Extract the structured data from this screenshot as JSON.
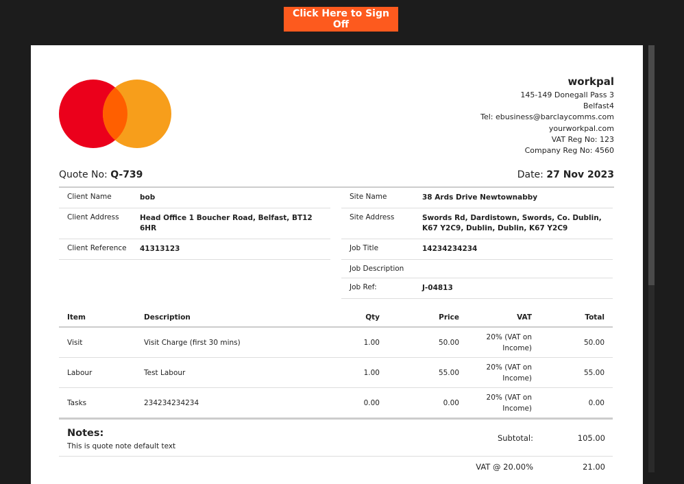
{
  "signoff_button": "Click Here to Sign Off",
  "company": {
    "name": "workpal",
    "address1": "145-149 Donegall Pass 3",
    "address2": "Belfast4",
    "tel": "Tel: ebusiness@barclaycomms.com",
    "web": "yourworkpal.com",
    "vat_reg": "VAT Reg No: 123",
    "company_reg": "Company Reg No: 4560"
  },
  "logo": {
    "left_color": "#eb001b",
    "right_color": "#f79e1b",
    "overlap_color": "#ff5f00"
  },
  "quote": {
    "label": "Quote No: ",
    "number": "Q-739"
  },
  "date": {
    "label": "Date: ",
    "value": "27 Nov 2023"
  },
  "client_info": [
    {
      "label": "Client Name",
      "value": "bob"
    },
    {
      "label": "Client Address",
      "value": "Head Office 1 Boucher Road, Belfast, BT12 6HR"
    },
    {
      "label": "Client Reference",
      "value": "41313123"
    }
  ],
  "site_info": [
    {
      "label": "Site Name",
      "value": "38 Ards Drive Newtownabby"
    },
    {
      "label": "Site Address",
      "value": "Swords Rd, Dardistown, Swords, Co. Dublin, K67 Y2C9, Dublin, Dublin, K67 Y2C9"
    },
    {
      "label": "Job Title",
      "value": "14234234234"
    },
    {
      "label": "Job Description",
      "value": ""
    },
    {
      "label": "Job Ref:",
      "value": "J-04813"
    }
  ],
  "items_table": {
    "headers": {
      "item": "Item",
      "description": "Description",
      "qty": "Qty",
      "price": "Price",
      "vat": "VAT",
      "total": "Total"
    },
    "rows": [
      {
        "item": "Visit",
        "description": "Visit Charge (first 30 mins)",
        "qty": "1.00",
        "price": "50.00",
        "vat_line1": "20% (VAT on",
        "vat_line2": "Income)",
        "total": "50.00"
      },
      {
        "item": "Labour",
        "description": "Test Labour",
        "qty": "1.00",
        "price": "55.00",
        "vat_line1": "20% (VAT on",
        "vat_line2": "Income)",
        "total": "55.00"
      },
      {
        "item": "Tasks",
        "description": "234234234234",
        "qty": "0.00",
        "price": "0.00",
        "vat_line1": "20% (VAT on",
        "vat_line2": "Income)",
        "total": "0.00"
      }
    ]
  },
  "notes": {
    "title": "Notes:",
    "text": "This is quote note default text"
  },
  "totals": {
    "subtotal_label": "Subtotal:",
    "subtotal_value": "105.00",
    "vat_label": "VAT @ 20.00%",
    "vat_value": "21.00"
  }
}
